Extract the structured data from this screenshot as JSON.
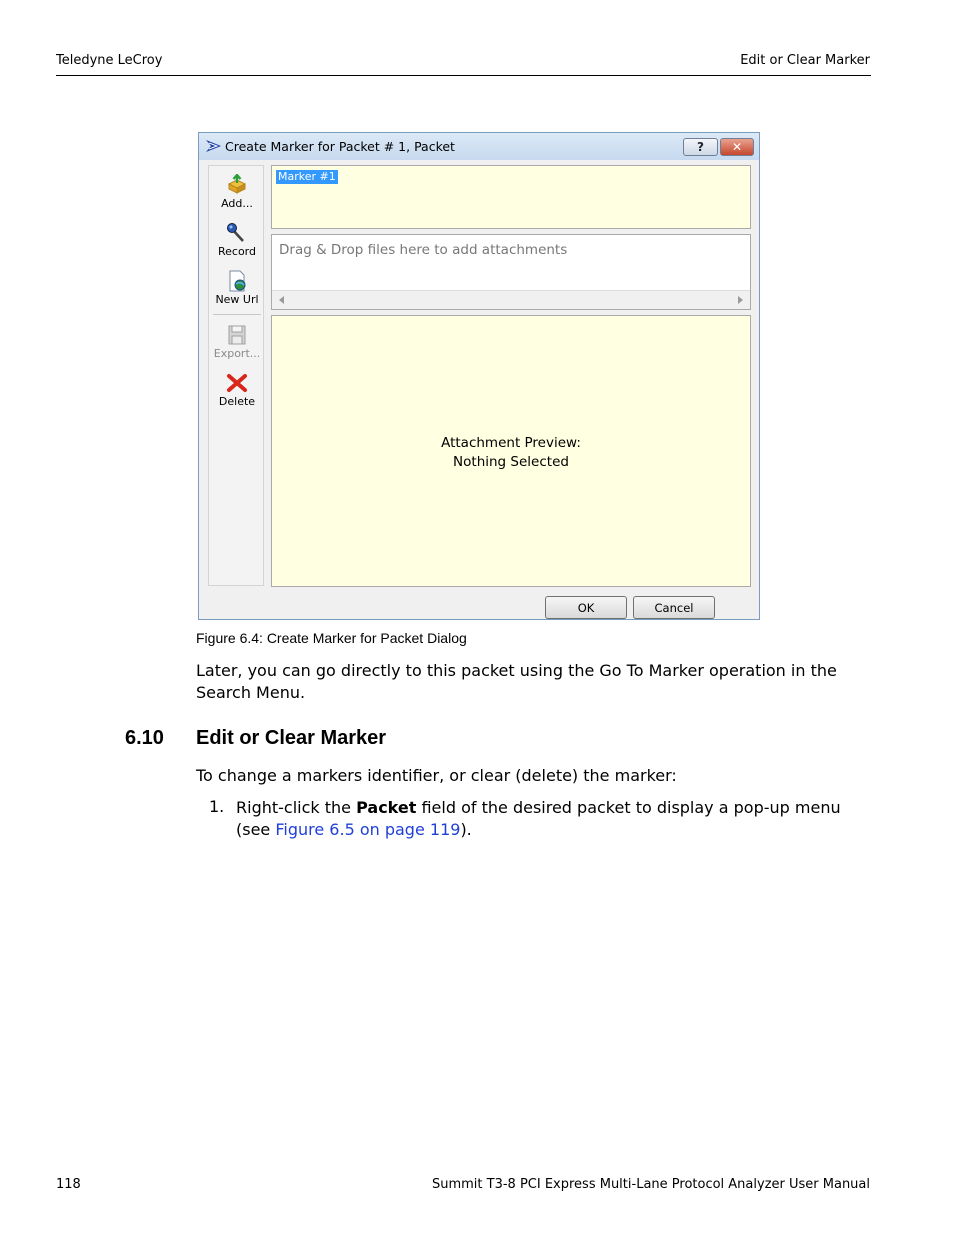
{
  "header": {
    "left": "Teledyne LeCroy",
    "right": "Edit or Clear Marker"
  },
  "dialog": {
    "title": "Create Marker for Packet # 1, Packet",
    "help_label": "?",
    "close_label": "✕",
    "toolbar": {
      "add": "Add...",
      "record": "Record",
      "new_url": "New Url",
      "export": "Export...",
      "delete": "Delete"
    },
    "marker_text": "Marker #1",
    "attach_hint": "Drag & Drop files here to add attachments",
    "preview_line1": "Attachment Preview:",
    "preview_line2": "Nothing Selected",
    "ok_label": "OK",
    "cancel_label": "Cancel"
  },
  "caption": "Figure 6.4:  Create Marker for Packet Dialog",
  "para1": "Later, you can go directly to this packet using the Go To Marker operation in the Search Menu.",
  "section": {
    "number": "6.10",
    "title": "Edit or Clear Marker"
  },
  "para2": "To change a markers identifier, or clear (delete) the marker:",
  "step1": {
    "number": "1.",
    "before": "Right-click the ",
    "bold": "Packet",
    "after": " field of the desired packet to display a pop-up menu (see ",
    "link": "Figure 6.5 on page 119",
    "end": ")."
  },
  "footer": {
    "page": "118",
    "title": "Summit T3-8 PCI Express Multi-Lane Protocol Analyzer User Manual"
  }
}
